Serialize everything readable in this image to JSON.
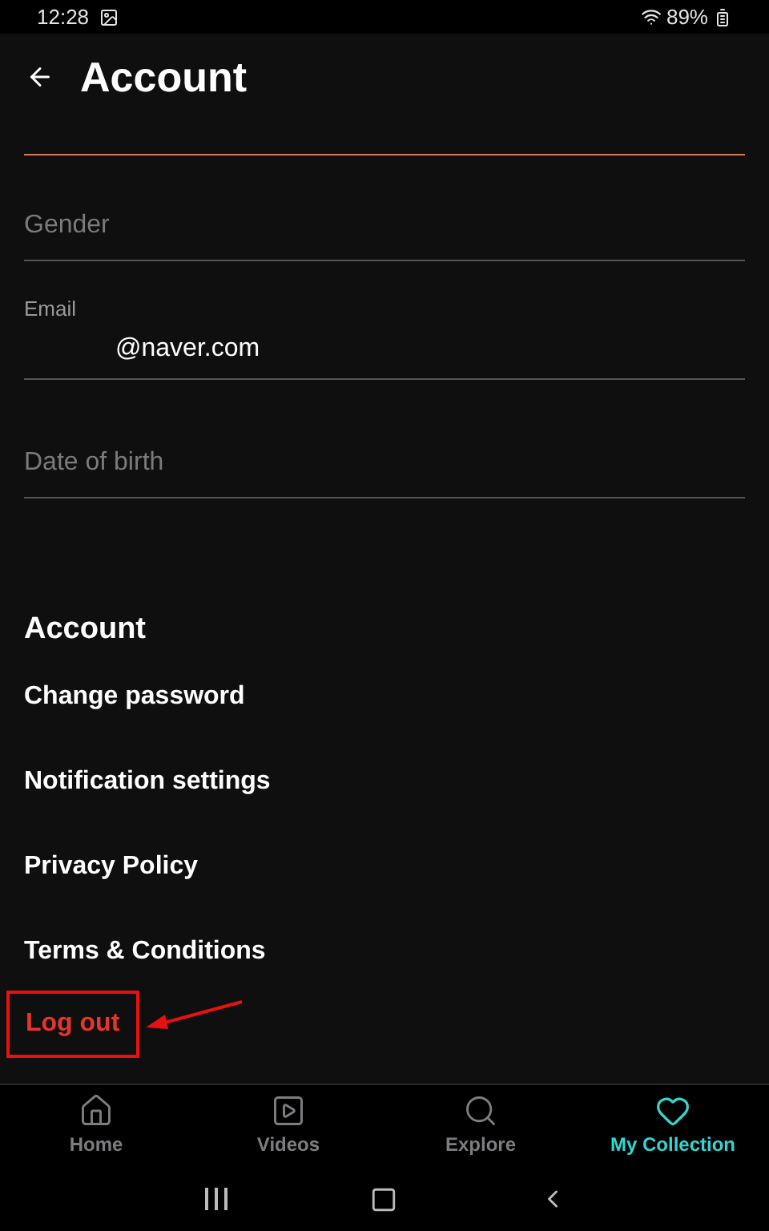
{
  "status_bar": {
    "time": "12:28",
    "battery": "89%"
  },
  "header": {
    "title": "Account"
  },
  "fields": [
    {
      "kind": "blank",
      "focused": true
    },
    {
      "kind": "placeholder",
      "placeholder": "Gender",
      "focused": false
    },
    {
      "kind": "filled",
      "label": "Email",
      "value": "@naver.com",
      "focused": false
    },
    {
      "kind": "placeholder",
      "placeholder": "Date of birth",
      "focused": false
    }
  ],
  "section": {
    "title": "Account",
    "items": [
      "Change password",
      "Notification settings",
      "Privacy Policy",
      "Terms & Conditions"
    ]
  },
  "log_out": {
    "label": "Log out",
    "highlighted": true
  },
  "bottom_nav": [
    {
      "label": "Home",
      "kind": "home",
      "selected": false
    },
    {
      "label": "Videos",
      "kind": "video",
      "selected": false
    },
    {
      "label": "Explore",
      "kind": "search",
      "selected": false
    },
    {
      "label": "My Collection",
      "kind": "heart",
      "selected": true
    }
  ]
}
